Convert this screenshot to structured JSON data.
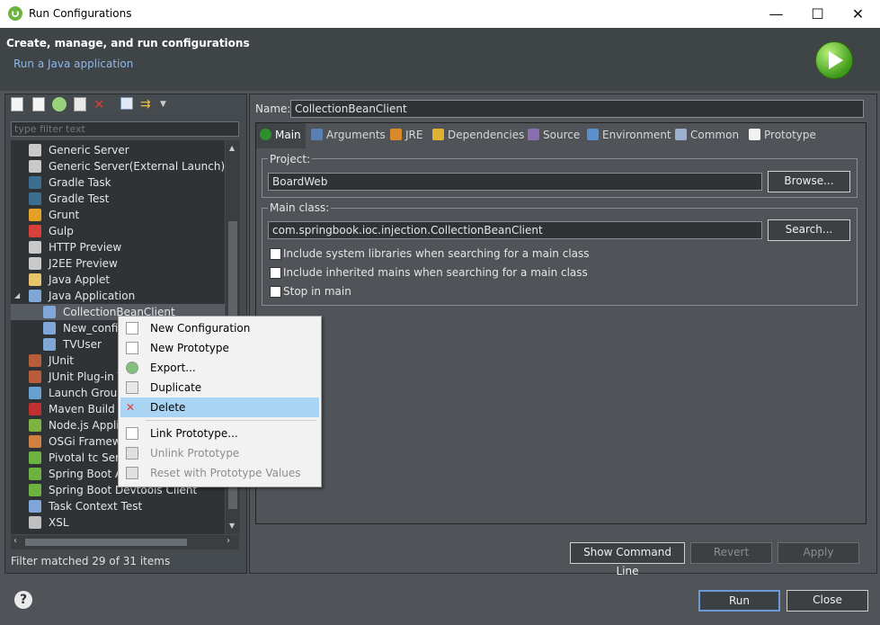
{
  "window": {
    "title": "Run Configurations",
    "minimize": "—",
    "maximize": "☐",
    "close": "✕"
  },
  "header": {
    "title": "Create, manage, and run configurations",
    "subtitle": "Run a Java application"
  },
  "left": {
    "filter_placeholder": "type filter text",
    "items": [
      {
        "label": "Generic Server",
        "icon": "server-icon",
        "color": "#c9c9c9"
      },
      {
        "label": "Generic Server(External Launch)",
        "icon": "server-icon",
        "color": "#c9c9c9"
      },
      {
        "label": "Gradle Task",
        "icon": "gradle-icon",
        "color": "#3c6e8f"
      },
      {
        "label": "Gradle Test",
        "icon": "gradle-icon",
        "color": "#3c6e8f"
      },
      {
        "label": "Grunt",
        "icon": "grunt-icon",
        "color": "#e4a126"
      },
      {
        "label": "Gulp",
        "icon": "gulp-icon",
        "color": "#d9403a"
      },
      {
        "label": "HTTP Preview",
        "icon": "server-icon",
        "color": "#c9c9c9"
      },
      {
        "label": "J2EE Preview",
        "icon": "server-icon",
        "color": "#c9c9c9"
      },
      {
        "label": "Java Applet",
        "icon": "applet-icon",
        "color": "#e8c46a"
      },
      {
        "label": "Java Application",
        "icon": "java-app-icon",
        "color": "#7fa7d8"
      },
      {
        "label": "CollectionBeanClient",
        "icon": "java-app-icon",
        "color": "#7fa7d8"
      },
      {
        "label": "New_configu",
        "icon": "java-app-icon",
        "color": "#7fa7d8"
      },
      {
        "label": "TVUser",
        "icon": "java-app-icon",
        "color": "#7fa7d8"
      },
      {
        "label": "JUnit",
        "icon": "junit-icon",
        "color": "#b85c3c"
      },
      {
        "label": "JUnit Plug-in T",
        "icon": "junit-icon",
        "color": "#b85c3c"
      },
      {
        "label": "Launch Group",
        "icon": "launch-group-icon",
        "color": "#6aa0d0"
      },
      {
        "label": "Maven Build",
        "icon": "maven-icon",
        "color": "#c03030"
      },
      {
        "label": "Node.js Applic",
        "icon": "nodejs-icon",
        "color": "#7db340"
      },
      {
        "label": "OSGi Framewo",
        "icon": "osgi-icon",
        "color": "#d08040"
      },
      {
        "label": "Pivotal tc Serv",
        "icon": "tc-server-icon",
        "color": "#6db33f"
      },
      {
        "label": "Spring Boot A",
        "icon": "spring-boot-icon",
        "color": "#6db33f"
      },
      {
        "label": "Spring Boot Devtools Client",
        "icon": "spring-boot-icon",
        "color": "#6db33f"
      },
      {
        "label": "Task Context Test",
        "icon": "task-icon",
        "color": "#7fa7d8"
      },
      {
        "label": "XSL",
        "icon": "xsl-icon",
        "color": "#c0c0c0"
      }
    ],
    "status": "Filter matched 29 of 31 items"
  },
  "right": {
    "name_label": "Name:",
    "name_value": "CollectionBeanClient",
    "tabs": [
      {
        "label": "Main",
        "icon": "main-tab-icon"
      },
      {
        "label": "Arguments",
        "icon": "arguments-tab-icon"
      },
      {
        "label": "JRE",
        "icon": "jre-tab-icon"
      },
      {
        "label": "Dependencies",
        "icon": "dependencies-tab-icon"
      },
      {
        "label": "Source",
        "icon": "source-tab-icon"
      },
      {
        "label": "Environment",
        "icon": "environment-tab-icon"
      },
      {
        "label": "Common",
        "icon": "common-tab-icon"
      },
      {
        "label": "Prototype",
        "icon": "prototype-tab-icon"
      }
    ],
    "project_label": "Project:",
    "project_value": "BoardWeb",
    "browse": "Browse...",
    "main_class_label": "Main class:",
    "main_class_value": "com.springbook.ioc.injection.CollectionBeanClient",
    "search": "Search...",
    "checks": [
      "Include system libraries when searching for a main class",
      "Include inherited mains when searching for a main class",
      "Stop in main"
    ],
    "show_cmd": "Show Command Line",
    "revert": "Revert",
    "apply": "Apply"
  },
  "context_menu": {
    "items": [
      {
        "label": "New Configuration",
        "icon": "new-config-icon",
        "state": "normal"
      },
      {
        "label": "New Prototype",
        "icon": "new-prototype-icon",
        "state": "normal"
      },
      {
        "label": "Export...",
        "icon": "export-icon",
        "state": "normal"
      },
      {
        "label": "Duplicate",
        "icon": "duplicate-icon",
        "state": "normal"
      },
      {
        "label": "Delete",
        "icon": "delete-icon",
        "state": "highlighted"
      },
      {
        "label": "Link Prototype...",
        "icon": "link-prototype-icon",
        "state": "normal"
      },
      {
        "label": "Unlink Prototype",
        "icon": "unlink-prototype-icon",
        "state": "disabled"
      },
      {
        "label": "Reset with Prototype Values",
        "icon": "reset-prototype-icon",
        "state": "disabled"
      }
    ]
  },
  "footer": {
    "run": "Run",
    "close": "Close",
    "help": "?"
  }
}
